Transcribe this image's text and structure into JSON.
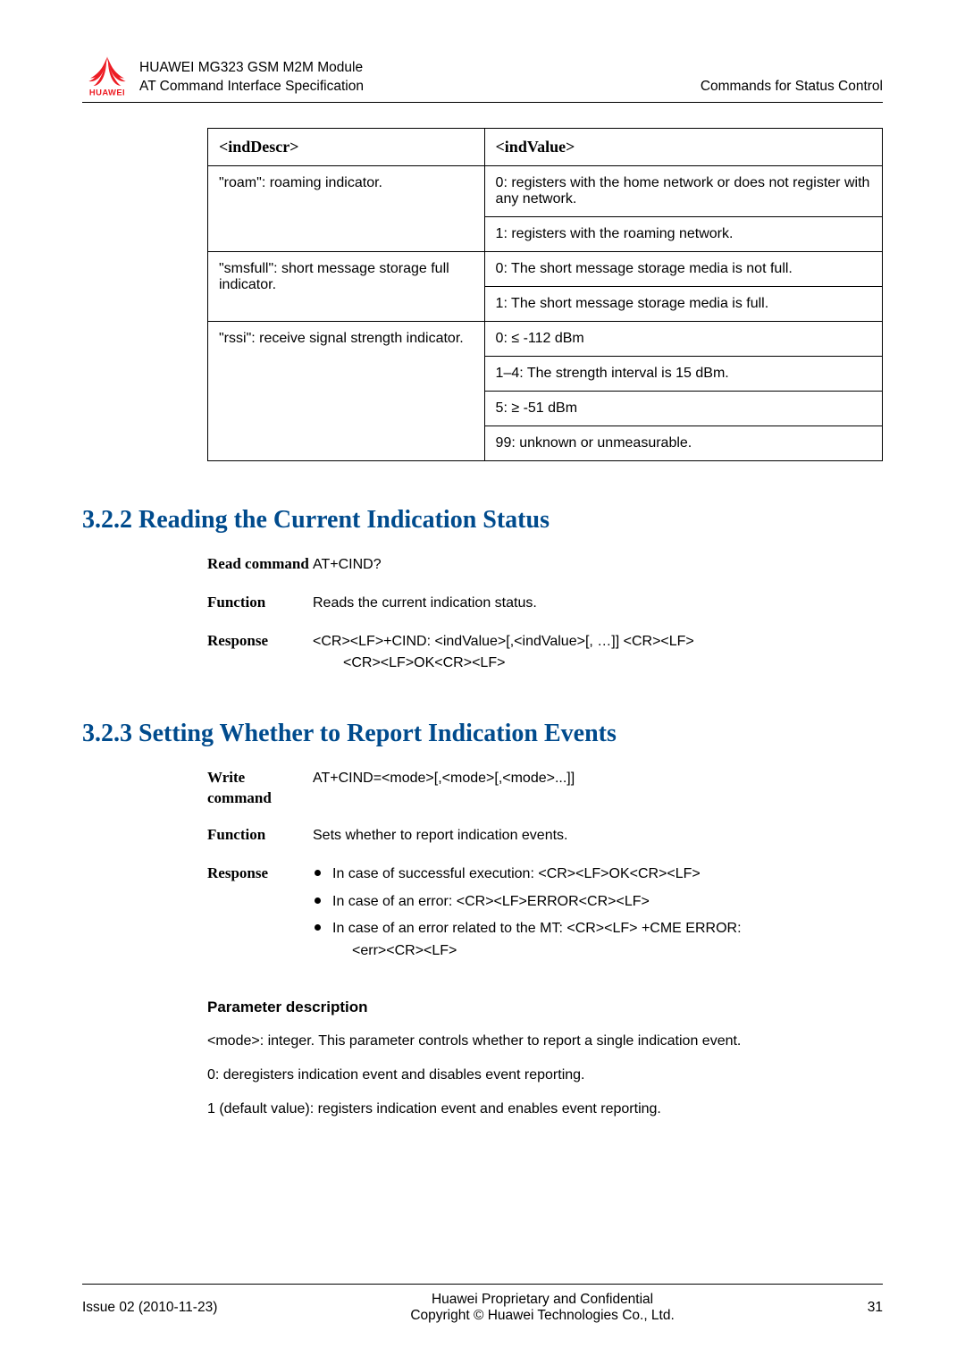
{
  "header": {
    "product": "HUAWEI MG323 GSM M2M Module",
    "subtitle": "AT Command Interface Specification",
    "right": "Commands for Status Control",
    "brand": "HUAWEI"
  },
  "table": {
    "head_descr": "<indDescr>",
    "head_value": "<indValue>",
    "rows": [
      {
        "d": "\"roam\": roaming indicator.",
        "v": [
          "0: registers with the home network or does not register with any network.",
          "1: registers with the roaming network."
        ]
      },
      {
        "d": "\"smsfull\": short message storage full indicator.",
        "v": [
          "0: The short message storage media is not full.",
          "1: The short message storage media is full."
        ]
      },
      {
        "d": "\"rssi\": receive signal strength indicator.",
        "v": [
          "0: ≤ -112 dBm",
          "1–4: The strength interval is 15 dBm.",
          "5: ≥ -51 dBm",
          "99: unknown or unmeasurable."
        ]
      }
    ]
  },
  "section_322": {
    "title": "3.2.2 Reading the Current Indication Status",
    "read_label": "Read command",
    "read_cmd": "AT+CIND?",
    "func_label": "Function",
    "func_text": "Reads the current indication status.",
    "resp_label": "Response",
    "resp_line1": "<CR><LF>+CIND: <indValue>[,<indValue>[, …]] <CR><LF>",
    "resp_line2": "<CR><LF>OK<CR><LF>"
  },
  "section_323": {
    "title": "3.2.3 Setting Whether to Report Indication Events",
    "write_label": "Write command",
    "write_cmd": "AT+CIND=<mode>[,<mode>[,<mode>...]]",
    "func_label": "Function",
    "func_text": "Sets whether to report indication events.",
    "resp_label": "Response",
    "resp_items": [
      "In case of successful execution: <CR><LF>OK<CR><LF>",
      "In case of an error: <CR><LF>ERROR<CR><LF>",
      "In case of an error related to the MT: <CR><LF> +CME ERROR:"
    ],
    "resp_sub": "<err><CR><LF>"
  },
  "param": {
    "title": "Parameter description",
    "line1": "<mode>: integer. This parameter controls whether to report a single indication event.",
    "line2": "0: deregisters indication event and disables event reporting.",
    "line3": "1 (default value): registers indication event and enables event reporting."
  },
  "footer": {
    "left": "Issue 02 (2010-11-23)",
    "center1": "Huawei Proprietary and Confidential",
    "center2": "Copyright © Huawei Technologies Co., Ltd.",
    "right": "31"
  }
}
